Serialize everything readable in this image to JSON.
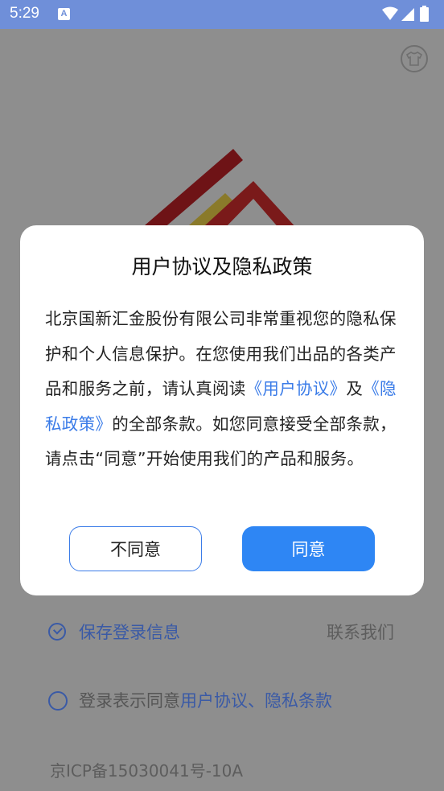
{
  "status_bar": {
    "time": "5:29",
    "app_icon_letter": "A"
  },
  "background": {
    "save_login_label": "保存登录信息",
    "contact_label": "联系我们",
    "agree_prefix": "登录表示同意",
    "agree_links": "用户协议、隐私条款",
    "icp": "京ICP备15030041号-10A"
  },
  "dialog": {
    "title": "用户协议及隐私政策",
    "body_1": "北京国新汇金股份有限公司非常重视您的隐私保护和个人信息保护。在您使用我们出品的各类产品和服务之前，请认真阅读",
    "link_user_agreement": "《用户协议》",
    "and": "及",
    "link_privacy": "《隐私政策》",
    "body_2": "的全部条款。如您同意接受全部条款，请点击“同意”开始使用我们的产品和服务。",
    "disagree_label": "不同意",
    "agree_label": "同意"
  },
  "colors": {
    "status_bar": "#6f8fd9",
    "link": "#3b7ce8",
    "primary_button": "#2e86f4",
    "overlay_bg": "#8e8e8e"
  }
}
